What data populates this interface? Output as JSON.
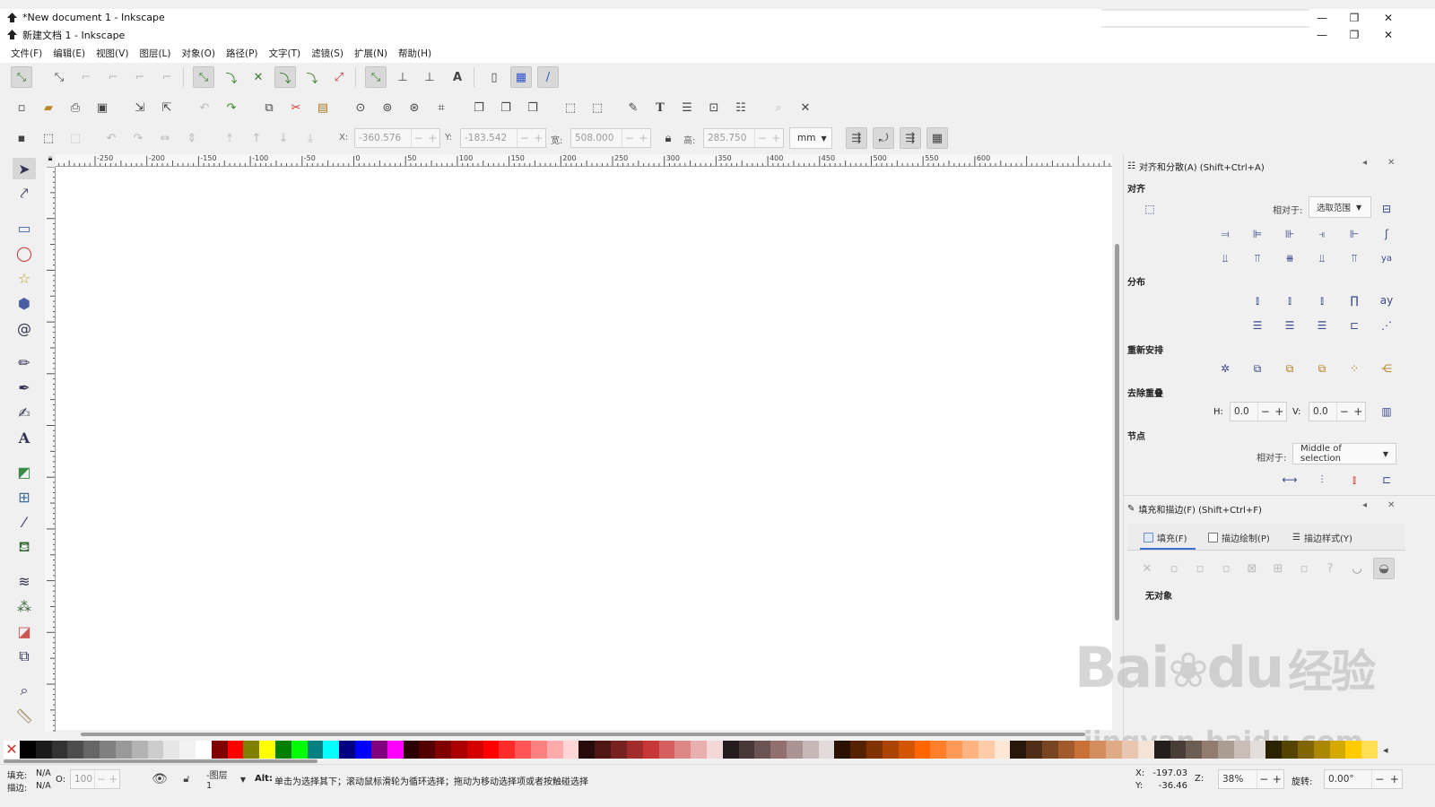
{
  "window": {
    "title_1": "*New document 1 - Inkscape",
    "title_2": "新建文档 1 - Inkscape",
    "minimize": "—",
    "restore": "❐",
    "close": "✕"
  },
  "menu": [
    "文件(F)",
    "编辑(E)",
    "视图(V)",
    "图层(L)",
    "对象(O)",
    "路径(P)",
    "文字(T)",
    "滤镜(S)",
    "扩展(N)",
    "帮助(H)"
  ],
  "select_toolbar": {
    "x_label": "X:",
    "x_value": "-360.576",
    "y_label": "Y:",
    "y_value": "-183.542",
    "w_label": "宽:",
    "w_value": "508.000",
    "h_label": "高:",
    "h_value": "285.750",
    "unit": "mm",
    "minus": "−",
    "plus": "+"
  },
  "ruler_ticks": [
    "-250",
    "-200",
    "-150",
    "-100",
    "-50",
    "0",
    "50",
    "100",
    "150",
    "200",
    "250",
    "300",
    "350",
    "400",
    "450",
    "500",
    "550",
    "600"
  ],
  "align_panel": {
    "title": "对齐和分散(A) (Shift+Ctrl+A)",
    "section_align": "对齐",
    "relative_label": "相对于:",
    "relative_value": "选取范围",
    "section_distribute": "分布",
    "section_rearrange": "重新安排",
    "section_overlap": "去除重叠",
    "h_label": "H:",
    "h_value": "0.0",
    "v_label": "V:",
    "v_value": "0.0",
    "section_nodes": "节点",
    "nodes_relative_label": "相对于:",
    "nodes_relative_value": "Middle of selection"
  },
  "fill_panel": {
    "title": "填充和描边(F) (Shift+Ctrl+F)",
    "tab_fill": "填充(F)",
    "tab_stroke_paint": "描边绘制(P)",
    "tab_stroke_style": "描边样式(Y)",
    "no_object": "无对象"
  },
  "status": {
    "fill_label": "填充:",
    "fill_value": "N/A",
    "stroke_label": "描边:",
    "stroke_value": "N/A",
    "opacity_label": "O:",
    "opacity_value": "100",
    "layer": "-图层 1",
    "message_key": "Alt:",
    "message": "单击为选择其下；滚动鼠标滑轮为循环选择；拖动为移动选择项或者按触碰选择",
    "x_label": "X:",
    "x_value": "-197.03",
    "y_label": "Y:",
    "y_value": "-36.46",
    "zoom_label": "Z:",
    "zoom_value": "38%",
    "rotate_label": "旋转:",
    "rotate_value": "0.00°"
  },
  "watermark": {
    "brand": "Bai",
    "brand2": "du",
    "chinese": "经验",
    "url": "jingyan.baidu.com"
  },
  "palette": [
    "#000000",
    "#1a1a1a",
    "#333333",
    "#4d4d4d",
    "#666666",
    "#808080",
    "#999999",
    "#b3b3b3",
    "#cccccc",
    "#e6e6e6",
    "#f2f2f2",
    "#ffffff",
    "#800000",
    "#ff0000",
    "#808000",
    "#ffff00",
    "#008000",
    "#00ff00",
    "#008080",
    "#00ffff",
    "#000080",
    "#0000ff",
    "#800080",
    "#ff00ff",
    "#2b0000",
    "#550000",
    "#800000",
    "#aa0000",
    "#d40000",
    "#ff0000",
    "#ff2a2a",
    "#ff5555",
    "#ff8080",
    "#ffaaaa",
    "#ffd5d5",
    "#280b0b",
    "#501616",
    "#782121",
    "#a02c2c",
    "#c83737",
    "#d35f5f",
    "#de8787",
    "#e9afaf",
    "#f4d7d7",
    "#241c1c",
    "#483737",
    "#6c5353",
    "#916f6f",
    "#ac9393",
    "#c8b7b7",
    "#e3dbdb",
    "#2b1100",
    "#552200",
    "#803300",
    "#aa4400",
    "#d45500",
    "#ff6600",
    "#ff7f2a",
    "#ff9955",
    "#ffb380",
    "#ffccaa",
    "#ffe6d5",
    "#28170b",
    "#502d16",
    "#784421",
    "#a05a2c",
    "#c87137",
    "#d38d5f",
    "#deaa87",
    "#e9c6af",
    "#f4e3d7",
    "#241f1c",
    "#483e37",
    "#6c5d53",
    "#917c6f",
    "#ac9d93",
    "#c8beb7",
    "#e3dedb",
    "#2b2200",
    "#554400",
    "#806600",
    "#aa8800",
    "#d4aa00",
    "#ffcc00",
    "#ffdd55"
  ]
}
